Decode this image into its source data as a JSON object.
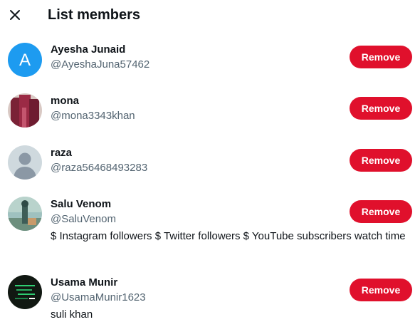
{
  "header": {
    "title": "List members",
    "close_icon": "close-icon"
  },
  "colors": {
    "remove_button": "#e0102c",
    "handle_text": "#536471",
    "avatar_letter_bg": "#1d9bf0"
  },
  "members": [
    {
      "name": "Ayesha Junaid",
      "handle": "@AyeshaJuna57462",
      "bio": "",
      "avatar_letter": "A",
      "remove_label": "Remove"
    },
    {
      "name": "mona",
      "handle": "@mona3343khan",
      "bio": "",
      "avatar_letter": "",
      "remove_label": "Remove"
    },
    {
      "name": "raza",
      "handle": "@raza56468493283",
      "bio": "",
      "avatar_letter": "",
      "remove_label": "Remove"
    },
    {
      "name": "Salu Venom",
      "handle": "@SaluVenom",
      "bio": "$ Instagram followers $ Twitter followers $ YouTube subscribers watch time",
      "avatar_letter": "",
      "remove_label": "Remove"
    },
    {
      "name": "Usama Munir",
      "handle": "@UsamaMunir1623",
      "bio": "suli khan",
      "avatar_letter": "",
      "remove_label": "Remove"
    }
  ]
}
